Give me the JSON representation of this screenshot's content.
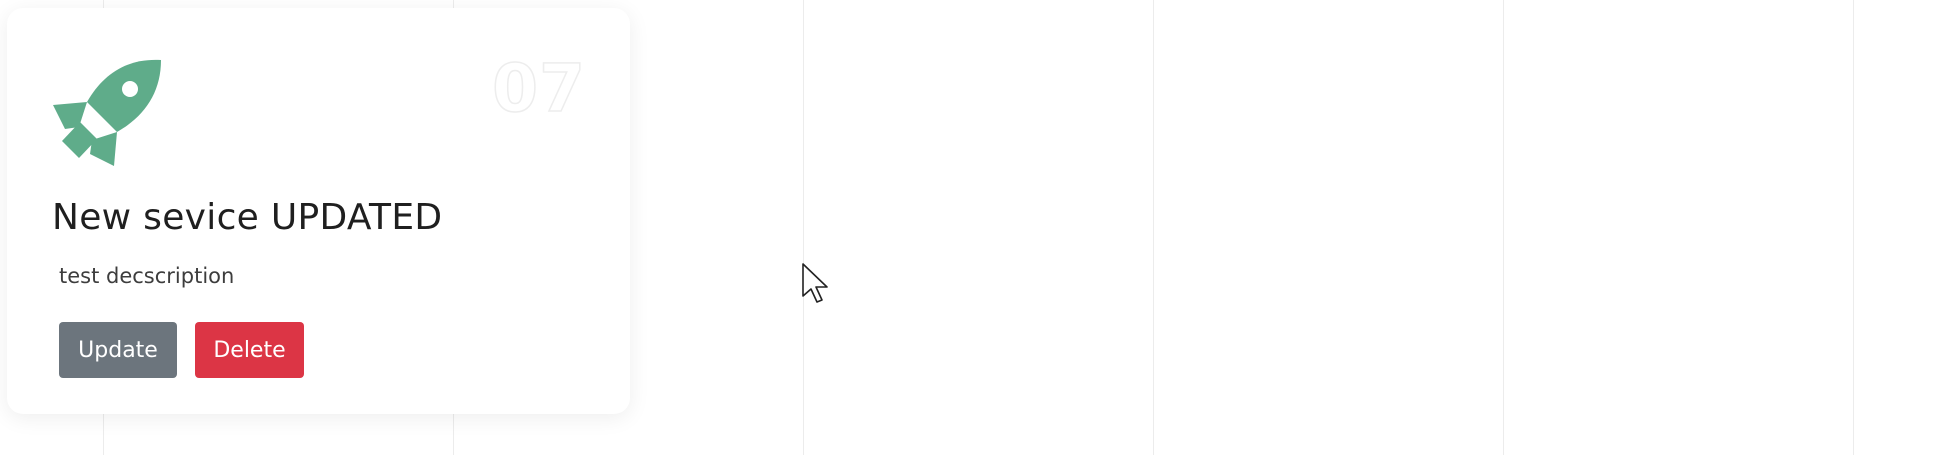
{
  "service_card": {
    "number": "07",
    "title": "New sevice UPDATED",
    "description": "test decscription",
    "icon": "rocket-icon",
    "accent_color": "#5fac8a",
    "update_label": "Update",
    "delete_label": "Delete",
    "update_color": "#6c757d",
    "delete_color": "#dc3545"
  },
  "cursor": {
    "icon": "mouse-pointer-icon"
  }
}
